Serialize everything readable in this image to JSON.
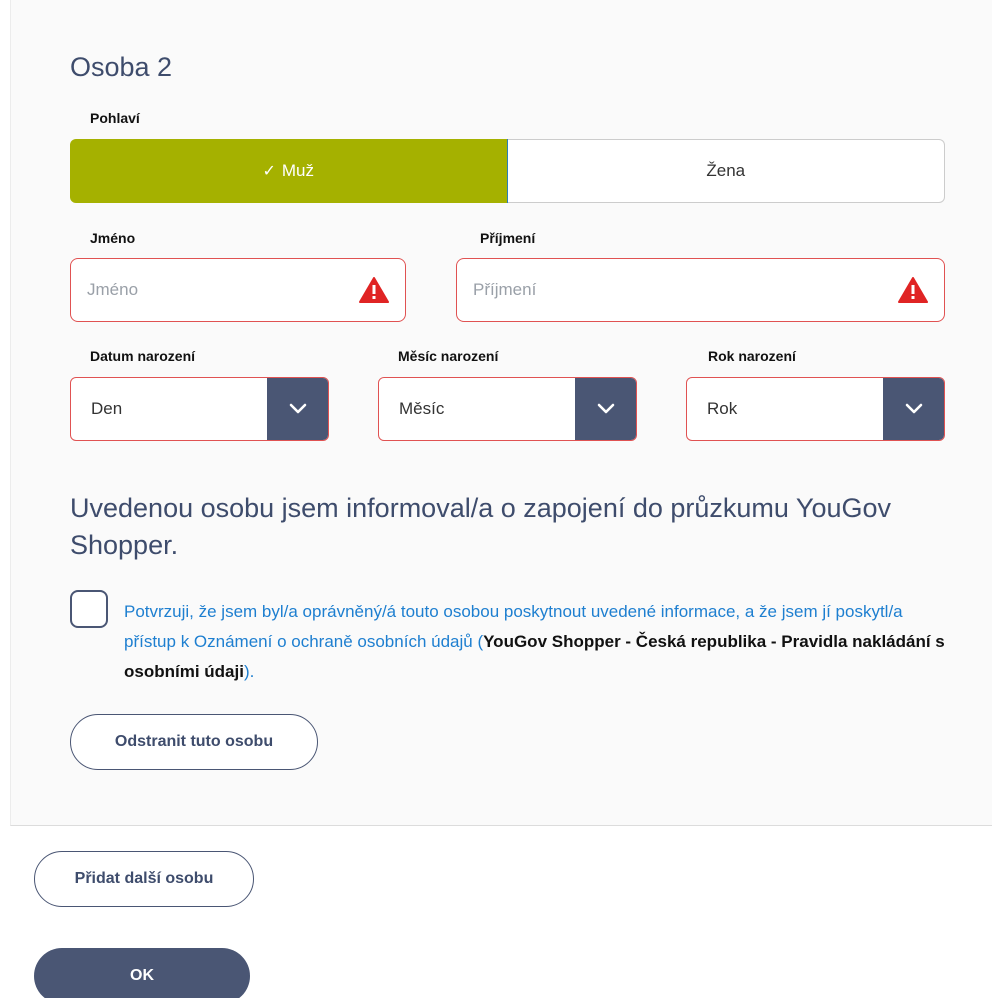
{
  "person": {
    "title": "Osoba 2",
    "gender": {
      "label": "Pohlaví",
      "options": [
        "Muž",
        "Žena"
      ],
      "selected": "Muž"
    },
    "first_name": {
      "label": "Jméno",
      "placeholder": "Jméno"
    },
    "last_name": {
      "label": "Příjmení",
      "placeholder": "Příjmení"
    },
    "birth_day": {
      "label": "Datum narození",
      "value": "Den"
    },
    "birth_month": {
      "label": "Měsíc narození",
      "value": "Měsíc"
    },
    "birth_year": {
      "label": "Rok narození",
      "value": "Rok"
    },
    "notice": "Uvedenou osobu jsem informoval/a o zapojení do průzkumu YouGov Shopper.",
    "consent": {
      "text_start": "Potvrzuji, že jsem byl/a oprávněný/á touto osobou poskytnout uvedené informace, a že jsem jí poskytl/a přístup k Oznámení o ochraně osobních údajů (",
      "link": "YouGov Shopper - Česká republika - Pravidla nakládání s osobními údaji",
      "text_end": ").",
      "checked": false
    },
    "remove_label": "Odstranit tuto osobu"
  },
  "add_person_label": "Přidat další osobu",
  "ok_label": "OK",
  "colors": {
    "accent": "#a5b100",
    "navy": "#4a5674",
    "error": "#e05252",
    "link": "#1e7fd0"
  }
}
